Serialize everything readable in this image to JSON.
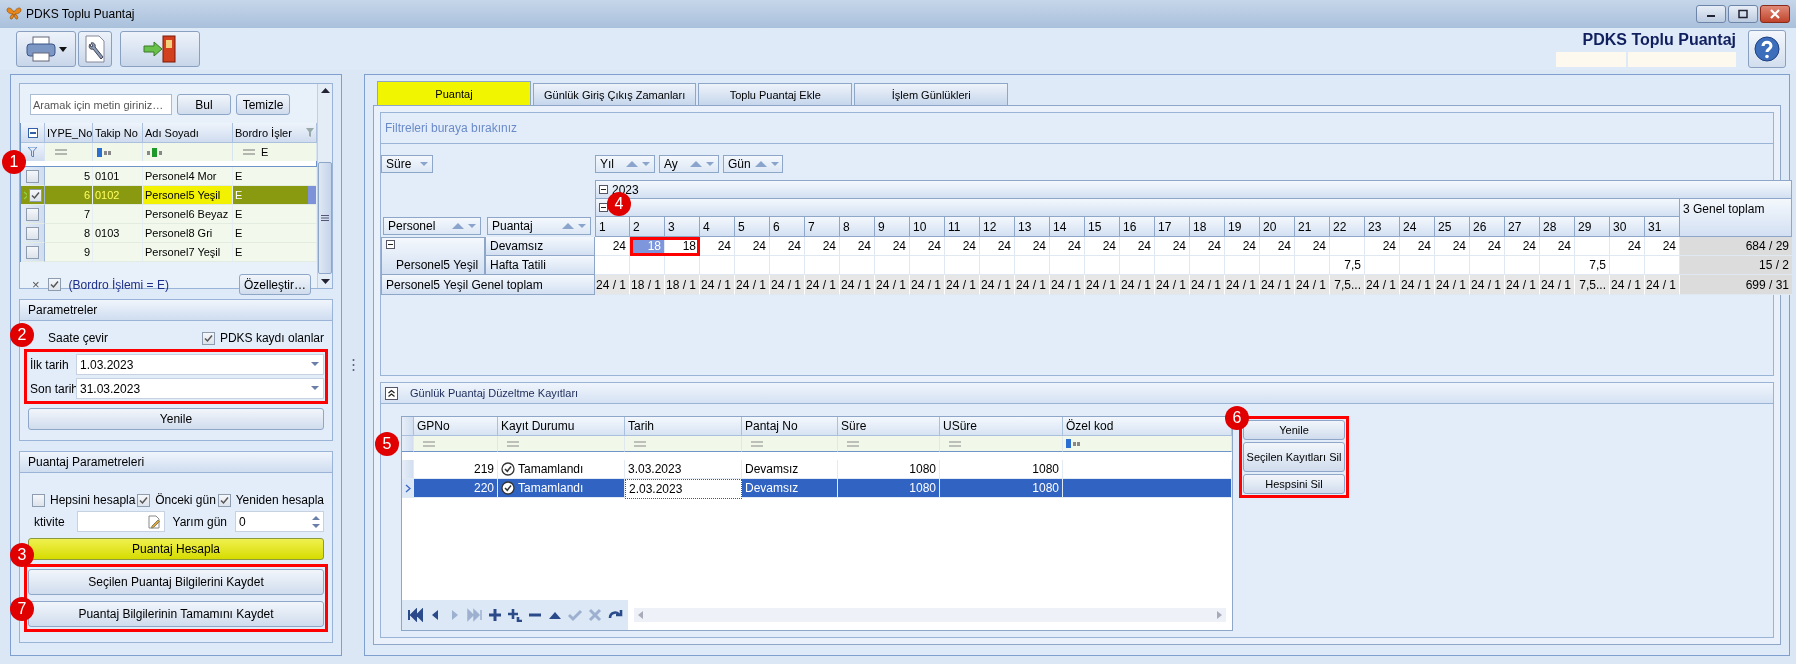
{
  "window": {
    "title": "PDKS Toplu Puantaj"
  },
  "header": {
    "title": "PDKS Toplu Puantaj"
  },
  "search": {
    "placeholder": "Aramak için metin giriniz…",
    "find": "Bul",
    "clear": "Temizle"
  },
  "personnel_grid": {
    "columns": [
      "IYPE_No",
      "Takip No",
      "Adı Soyadı",
      "Bordro İşler"
    ],
    "filter_value": "E",
    "rows": [
      {
        "iype_no": "5",
        "takip_no": "0101",
        "name": "Personel4 Mor",
        "bordro": "E",
        "checked": false,
        "selected": false
      },
      {
        "iype_no": "6",
        "takip_no": "0102",
        "name": "Personel5 Yeşil",
        "bordro": "E",
        "checked": true,
        "selected": true
      },
      {
        "iype_no": "7",
        "name": "Personel6 Beyaz",
        "bordro": "E",
        "checked": false,
        "selected": false
      },
      {
        "iype_no": "8",
        "takip_no": "0103",
        "name": "Personel8 Gri",
        "bordro": "E",
        "checked": false,
        "selected": false
      },
      {
        "iype_no": "9",
        "name": "Personel7 Yeşil",
        "bordro": "E",
        "checked": false,
        "selected": false
      }
    ],
    "filter": {
      "clear": "×",
      "enabled": true,
      "text": "(Bordro İşlemi = E)"
    },
    "customize": "Özelleştir…"
  },
  "parameters": {
    "title": "Parametreler",
    "convert_label": "Saate çevir",
    "pdks_only": {
      "label": "PDKS kaydı olanlar",
      "checked": true
    },
    "start": {
      "label": "İlk tarih",
      "value": "1.03.2023"
    },
    "end": {
      "label": "Son tarih",
      "value": "31.03.2023"
    },
    "refresh": "Yenile"
  },
  "calc_parameters": {
    "title": "Puantaj Parametreleri",
    "options": [
      {
        "label": "Hepsini hesapla",
        "checked": false
      },
      {
        "label": "Önceki gün",
        "checked": true
      },
      {
        "label": "Yeniden hesapla",
        "checked": true
      }
    ],
    "activity_label": "ktivite",
    "half_day": {
      "label": "Yarım gün",
      "value": "0"
    },
    "calculate": "Puantaj Hesapla",
    "save_buttons": [
      "Seçilen Puantaj Bilgilerini Kaydet",
      "Puantaj Bilgilerinin Tamamını Kaydet"
    ]
  },
  "tabs": [
    {
      "label": "Puantaj",
      "selected": true
    },
    {
      "label": "Günlük Giriş Çıkış Zamanları",
      "selected": false
    },
    {
      "label": "Toplu Puantaj Ekle",
      "selected": false
    },
    {
      "label": "İşlem Günlükleri",
      "selected": false
    }
  ],
  "pivot": {
    "filter_hint": "Filtreleri buraya bırakınız",
    "data_field": "Süre",
    "column_fields": [
      "Yıl",
      "Ay",
      "Gün"
    ],
    "row_fields": [
      "Personel",
      "Puantaj"
    ],
    "year": "2023",
    "days": [
      "1",
      "2",
      "3",
      "4",
      "5",
      "6",
      "7",
      "8",
      "9",
      "10",
      "11",
      "12",
      "13",
      "14",
      "15",
      "16",
      "17",
      "18",
      "19",
      "20",
      "21",
      "22",
      "23",
      "24",
      "25",
      "26",
      "27",
      "28",
      "29",
      "30",
      "31"
    ],
    "grand_total_label": "3 Genel toplam",
    "person": "Personel5 Yeşil",
    "rows": [
      {
        "label": "Devamsız",
        "total": "684 / 29",
        "cells": [
          {
            "value": "24",
            "selected": false
          },
          {
            "value": "18",
            "selected": true
          },
          {
            "value": "18",
            "selected": false
          },
          {
            "value": "24",
            "selected": false
          },
          {
            "value": "24",
            "selected": false
          },
          {
            "value": "24",
            "selected": false
          },
          {
            "value": "24",
            "selected": false
          },
          {
            "value": "24",
            "selected": false
          },
          {
            "value": "24",
            "selected": false
          },
          {
            "value": "24",
            "selected": false
          },
          {
            "value": "24",
            "selected": false
          },
          {
            "value": "24",
            "selected": false
          },
          {
            "value": "24",
            "selected": false
          },
          {
            "value": "24",
            "selected": false
          },
          {
            "value": "24",
            "selected": false
          },
          {
            "value": "24",
            "selected": false
          },
          {
            "value": "24",
            "selected": false
          },
          {
            "value": "24",
            "selected": false
          },
          {
            "value": "24",
            "selected": false
          },
          {
            "value": "24",
            "selected": false
          },
          {
            "value": "24",
            "selected": false
          },
          {
            "selected": false
          },
          {
            "value": "24",
            "selected": false
          },
          {
            "value": "24",
            "selected": false
          },
          {
            "value": "24",
            "selected": false
          },
          {
            "value": "24",
            "selected": false
          },
          {
            "value": "24",
            "selected": false
          },
          {
            "value": "24",
            "selected": false
          },
          {
            "selected": false
          },
          {
            "value": "24",
            "selected": false
          },
          {
            "value": "24",
            "selected": false
          }
        ]
      },
      {
        "label": "Hafta Tatili",
        "total": "15 / 2",
        "cells": [
          {
            "selected": false
          },
          {
            "selected": false
          },
          {
            "selected": false
          },
          {
            "selected": false
          },
          {
            "selected": false
          },
          {
            "selected": false
          },
          {
            "selected": false
          },
          {
            "selected": false
          },
          {
            "selected": false
          },
          {
            "selected": false
          },
          {
            "selected": false
          },
          {
            "selected": false
          },
          {
            "selected": false
          },
          {
            "selected": false
          },
          {
            "selected": false
          },
          {
            "selected": false
          },
          {
            "selected": false
          },
          {
            "selected": false
          },
          {
            "selected": false
          },
          {
            "selected": false
          },
          {
            "selected": false
          },
          {
            "value": "7,5",
            "selected": false
          },
          {
            "selected": false
          },
          {
            "selected": false
          },
          {
            "selected": false
          },
          {
            "selected": false
          },
          {
            "selected": false
          },
          {
            "selected": false
          },
          {
            "value": "7,5",
            "selected": false
          },
          {
            "selected": false
          },
          {
            "selected": false
          }
        ]
      }
    ],
    "totals_label": "Personel5 Yeşil Genel toplam",
    "totals": [
      "24 / 1",
      "18 / 1",
      "18 / 1",
      "24 / 1",
      "24 / 1",
      "24 / 1",
      "24 / 1",
      "24 / 1",
      "24 / 1",
      "24 / 1",
      "24 / 1",
      "24 / 1",
      "24 / 1",
      "24 / 1",
      "24 / 1",
      "24 / 1",
      "24 / 1",
      "24 / 1",
      "24 / 1",
      "24 / 1",
      "24 / 1",
      "7,5...",
      "24 / 1",
      "24 / 1",
      "24 / 1",
      "24 / 1",
      "24 / 1",
      "24 / 1",
      "7,5...",
      "24 / 1",
      "24 / 1"
    ],
    "grand_total": "699 / 31"
  },
  "corrections": {
    "title": "Günlük Puantaj Düzeltme Kayıtları",
    "columns": [
      "GPNo",
      "Kayıt Durumu",
      "Tarih",
      "Pantaj No",
      "Süre",
      "USüre",
      "Özel kod"
    ],
    "rows": [
      {
        "gpno": "219",
        "status": "Tamamlandı",
        "date": "3.03.2023",
        "type": "Devamsız",
        "sure": "1080",
        "usure": "1080",
        "selected": false
      },
      {
        "gpno": "220",
        "status": "Tamamlandı",
        "date": "2.03.2023",
        "type": "Devamsız",
        "sure": "1080",
        "usure": "1080",
        "selected": true
      }
    ],
    "buttons": [
      "Yenile",
      "Seçilen Kayıtları Sil",
      "Hespsini Sil"
    ]
  },
  "annotations": [
    {
      "number": "1",
      "outlined": false
    },
    {
      "number": "2",
      "outlined": true
    },
    {
      "number": "3",
      "outlined": false
    },
    {
      "number": "4",
      "outlined": true
    },
    {
      "number": "5",
      "outlined": false
    },
    {
      "number": "6",
      "outlined": true
    },
    {
      "number": "7",
      "outlined": true
    }
  ]
}
